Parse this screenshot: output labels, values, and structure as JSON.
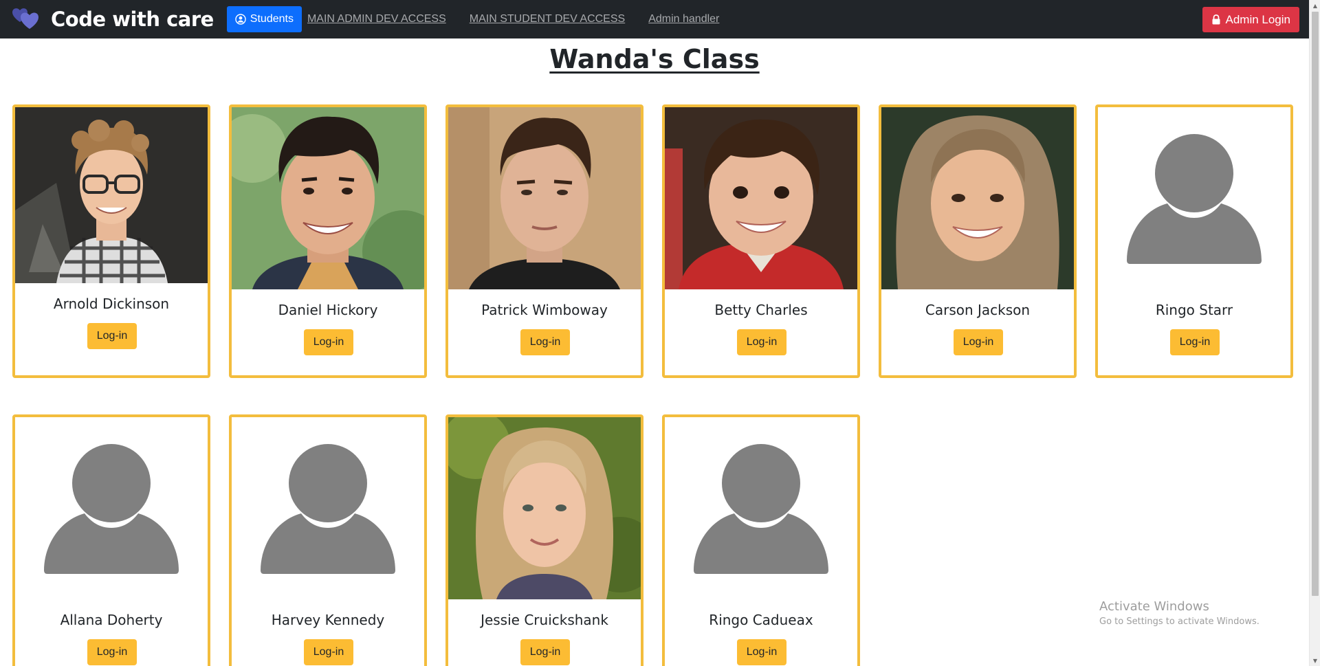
{
  "navbar": {
    "brand": "Code with care",
    "students_label": "Students",
    "links": [
      "MAIN ADMIN DEV ACCESS",
      "MAIN STUDENT DEV ACCESS",
      "Admin handler"
    ],
    "admin_login_label": "Admin Login"
  },
  "page": {
    "title": "Wanda's Class"
  },
  "students": [
    {
      "name": "Arnold Dickinson",
      "login_label": "Log-in",
      "photo": "photo-young-man-glasses"
    },
    {
      "name": "Daniel Hickory",
      "login_label": "Log-in",
      "photo": "photo-smiling-man"
    },
    {
      "name": "Patrick Wimboway",
      "login_label": "Log-in",
      "photo": "photo-young-man"
    },
    {
      "name": "Betty Charles",
      "login_label": "Log-in",
      "photo": "photo-little-girl"
    },
    {
      "name": "Carson Jackson",
      "login_label": "Log-in",
      "photo": "photo-smiling-child"
    },
    {
      "name": "Ringo Starr",
      "login_label": "Log-in",
      "photo": "default-avatar-icon"
    },
    {
      "name": "Allana Doherty",
      "login_label": "Log-in",
      "photo": "default-avatar-icon"
    },
    {
      "name": "Harvey Kennedy",
      "login_label": "Log-in",
      "photo": "default-avatar-icon"
    },
    {
      "name": "Jessie Cruickshank",
      "login_label": "Log-in",
      "photo": "photo-blonde-girl"
    },
    {
      "name": "Ringo Cadueax",
      "login_label": "Log-in",
      "photo": "default-avatar-icon"
    }
  ],
  "watermark": {
    "title": "Activate Windows",
    "subtitle": "Go to Settings to activate Windows."
  },
  "colors": {
    "navbar_bg": "#212529",
    "students_btn": "#0d6efd",
    "admin_btn": "#dc3545",
    "card_border": "#f3bd3d",
    "login_btn": "#fcbc33",
    "avatar_gray": "#808080"
  }
}
